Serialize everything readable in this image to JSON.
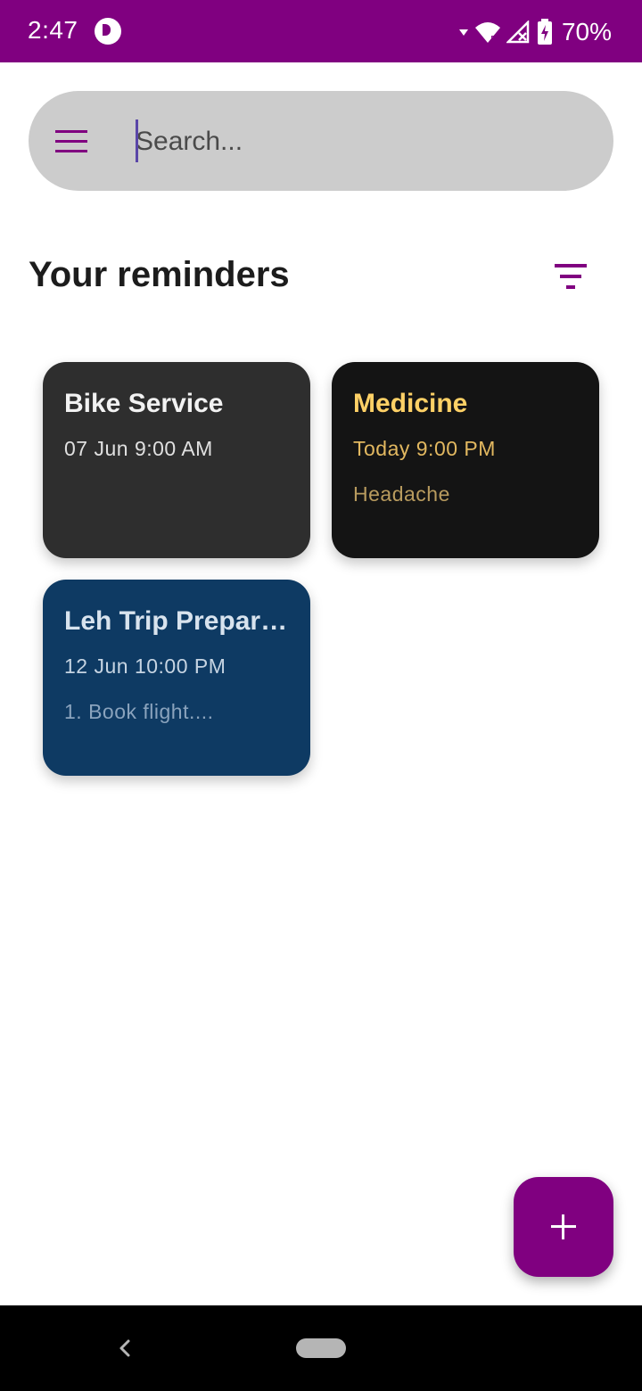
{
  "status_bar": {
    "time": "2:47",
    "battery": "70%",
    "color": "#800080"
  },
  "search": {
    "placeholder": "Search...",
    "value": ""
  },
  "header": {
    "title": "Your reminders"
  },
  "reminders": [
    {
      "title": "Bike Service",
      "date": "07 Jun 9:00 AM",
      "note": "",
      "bg": "#2e2e2e",
      "title_color": "#f2f2f2",
      "date_color": "#e0e0e0"
    },
    {
      "title": "Medicine",
      "date": "Today 9:00 PM",
      "note": "Headache",
      "bg": "#141414",
      "title_color": "#ffd166",
      "date_color": "#e2b860",
      "note_color": "#b89b5e"
    },
    {
      "title": "Leh Trip Preparation",
      "date": "12 Jun 10:00 PM",
      "note": "1. Book flight....",
      "bg": "#0e3a63",
      "title_color": "#d8e3ee",
      "date_color": "#c6d4e2",
      "note_color": "#8aa3bd"
    }
  ],
  "fab": {
    "label": "+"
  },
  "icons": [
    "menu-icon",
    "filter-icon",
    "add-icon",
    "wifi-icon",
    "signal-icon",
    "battery-icon",
    "back-icon"
  ]
}
